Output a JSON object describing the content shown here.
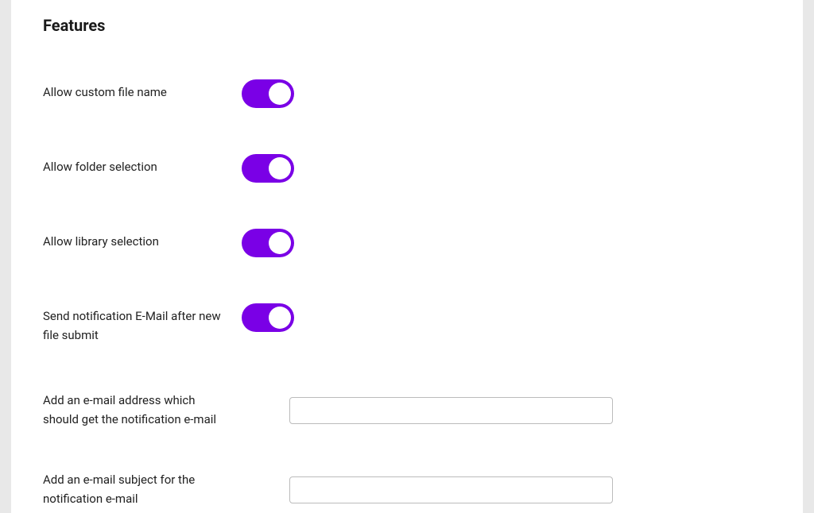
{
  "section": {
    "title": "Features"
  },
  "toggles": {
    "custom_file_name": {
      "label": "Allow custom file name",
      "on": true
    },
    "folder_selection": {
      "label": "Allow folder selection",
      "on": true
    },
    "library_selection": {
      "label": "Allow library selection",
      "on": true
    },
    "notification_email": {
      "label": "Send notification E-Mail after new file submit",
      "on": true
    }
  },
  "inputs": {
    "notification_address": {
      "label": "Add an e-mail address which should get the notification e-mail",
      "value": ""
    },
    "notification_subject": {
      "label": "Add an e-mail subject for the notification e-mail",
      "value": ""
    }
  },
  "colors": {
    "accent": "#7a00e6"
  }
}
